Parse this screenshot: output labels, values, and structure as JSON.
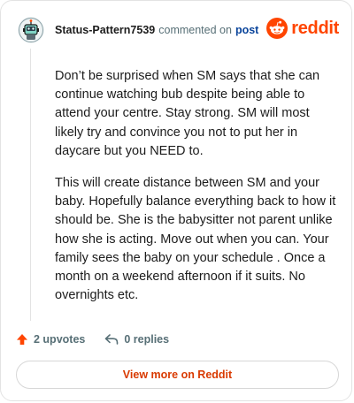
{
  "comment": {
    "username": "Status-Pattern7539",
    "commented_text": "commented on",
    "post_link": "post",
    "paragraphs": [
      "Don’t be surprised when SM says that she can continue watching bub despite being able to attend your centre. Stay strong. SM will most likely try and convince you not to put her in daycare but you NEED to.",
      "This will create distance between SM and your baby. Hopefully balance everything back to how it should be. She is the babysitter not parent unlike how she is acting. Move out when you can. Your family sees the baby on your schedule . Once a month on a weekend afternoon if it suits. No overnights etc."
    ]
  },
  "brand": {
    "wordmark": "reddit",
    "color": "#ff4500",
    "icon": "reddit-snoo-icon"
  },
  "actions": {
    "upvotes_label": "2 upvotes",
    "replies_label": "0 replies",
    "upvote_icon": "upvote-arrow-icon",
    "reply_icon": "reply-arrow-icon",
    "upvote_color": "#ff4500"
  },
  "view_button": {
    "label": "View more on Reddit"
  }
}
